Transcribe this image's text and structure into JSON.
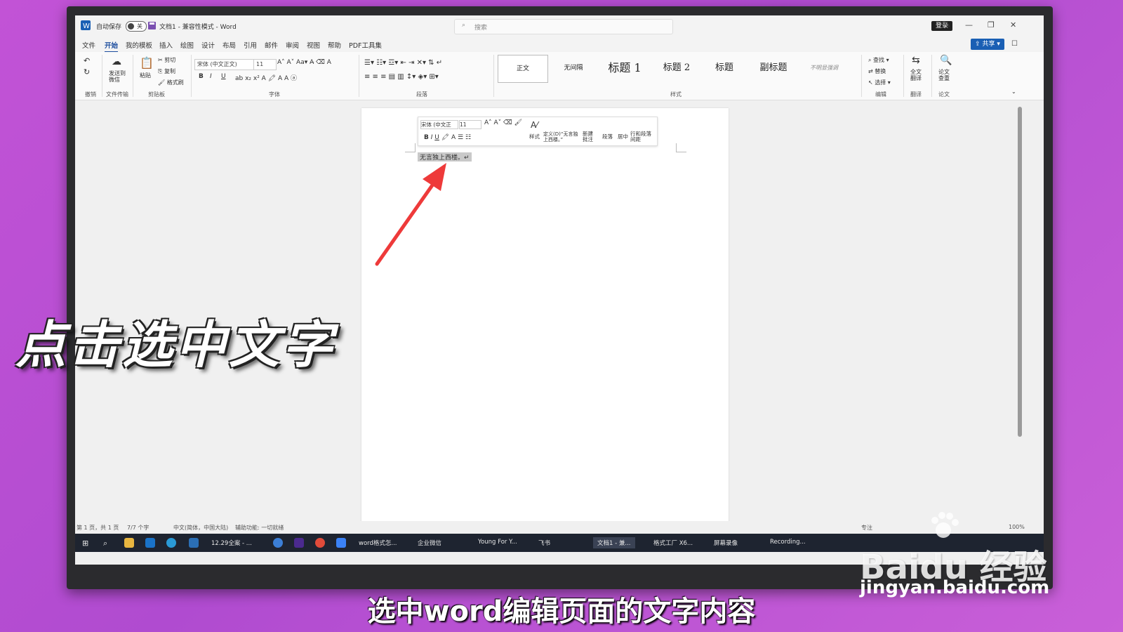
{
  "titlebar": {
    "autosave_label": "自动保存",
    "autosave_state": "关",
    "doc_title": "文档1 - 兼容性模式 - Word",
    "search_placeholder": "搜索",
    "login_label": "登录"
  },
  "menu": {
    "items": [
      "文件",
      "开始",
      "我的模板",
      "插入",
      "绘图",
      "设计",
      "布局",
      "引用",
      "邮件",
      "审阅",
      "视图",
      "帮助",
      "PDF工具集"
    ],
    "active": "开始",
    "share_label": "共享"
  },
  "ribbon": {
    "groups": {
      "undo": "撤销",
      "send": "文件传输",
      "clipboard": "剪贴板",
      "font": "字体",
      "paragraph": "段落",
      "styles": "样式",
      "editing": "编辑",
      "translate": "翻译",
      "paper": "论文"
    },
    "send_button": "发送到微信",
    "paste_button": "粘贴",
    "cut_button": "剪切",
    "copy_button": "复制",
    "format_painter": "格式刷",
    "font_name": "宋体 (中文正文)",
    "font_size": "11",
    "style_items": [
      "正文",
      "无间隔",
      "标题 1",
      "标题 2",
      "标题",
      "副标题",
      "不明显强调"
    ],
    "find": "查找",
    "replace": "替换",
    "select": "选择",
    "full_translate": "全文翻译",
    "paper_check": "论文查重"
  },
  "mini_toolbar": {
    "font_name": "宋体 (中文正",
    "font_size": "11",
    "styles_label": "样式",
    "define_label": "定义(D)“无言独上西楼。”",
    "new_comment": "新建批注",
    "paragraph": "段落",
    "center": "居中",
    "line_spacing": "行和段落间距"
  },
  "document": {
    "selected_text": "无言独上西楼。↵"
  },
  "statusbar": {
    "page": "第 1 页，共 1 页",
    "words": "7/7 个字",
    "language": "中文(简体，中国大陆)",
    "accessibility": "辅助功能: 一切就绪",
    "focus": "专注",
    "zoom": "100%"
  },
  "taskbar": {
    "items": [
      "12.29全案 - ...",
      "word格式怎...",
      "企业微信",
      "Young For Y...",
      "飞书",
      "文档1 - 兼...",
      "格式工厂 X6...",
      "屏幕录像",
      "Recording..."
    ]
  },
  "overlay": {
    "caption": "点击选中文字",
    "subtitle": "选中word编辑页面的文字内容",
    "watermark": "Baidu 经验",
    "watermark_url": "jingyan.baidu.com"
  },
  "colors": {
    "background": "#c253d6",
    "word_blue": "#1a5fb4",
    "arrow": "#ee3a3a"
  }
}
